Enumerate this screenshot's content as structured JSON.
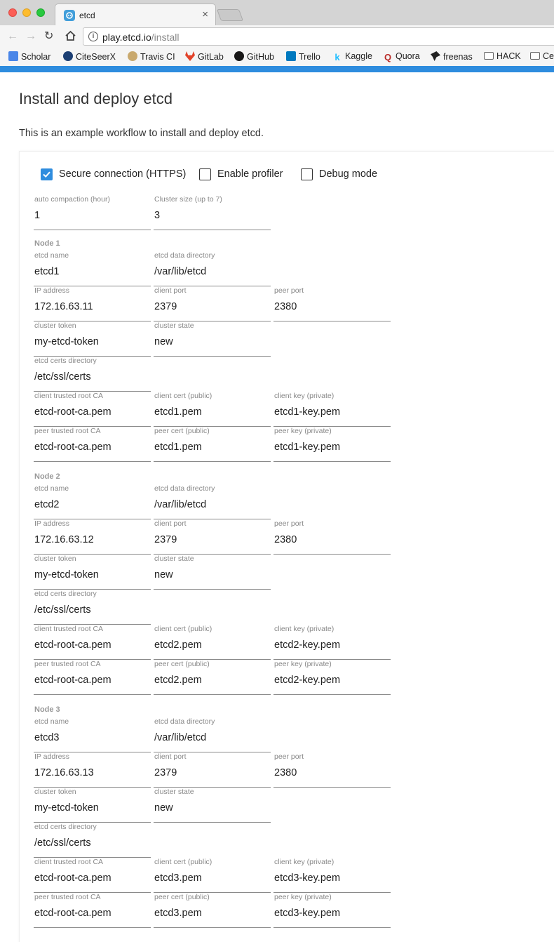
{
  "browser": {
    "tab_title": "etcd",
    "tab_close": "×",
    "url_host": "play.etcd.io",
    "url_path": "/install",
    "bookmarks": [
      "Scholar",
      "CiteSeerX",
      "Travis CI",
      "GitLab",
      "GitHub",
      "Trello",
      "Kaggle",
      "Quora",
      "freenas",
      "HACK",
      "Ce"
    ],
    "accent_color": "#2e8cde"
  },
  "page": {
    "title": "Install and deploy etcd",
    "description": "This is an example workflow to install and deploy etcd."
  },
  "options": {
    "secure": {
      "label": "Secure connection (HTTPS)",
      "checked": true
    },
    "profiler": {
      "label": "Enable profiler",
      "checked": false
    },
    "debug": {
      "label": "Debug mode",
      "checked": false
    }
  },
  "cluster": {
    "auto_compaction_label": "auto compaction (hour)",
    "auto_compaction": "1",
    "size_label": "Cluster size (up to 7)",
    "size": "3"
  },
  "labels": {
    "name": "etcd name",
    "data_dir": "etcd data directory",
    "ip": "IP address",
    "client_port": "client port",
    "peer_port": "peer port",
    "token": "cluster token",
    "state": "cluster state",
    "certs_dir": "etcd certs directory",
    "client_ca": "client trusted root CA",
    "client_cert": "client cert (public)",
    "client_key": "client key (private)",
    "peer_ca": "peer trusted root CA",
    "peer_cert": "peer cert (public)",
    "peer_key": "peer key (private)"
  },
  "nodes": [
    {
      "heading": "Node 1",
      "name": "etcd1",
      "data_dir": "/var/lib/etcd",
      "ip": "172.16.63.11",
      "client_port": "2379",
      "peer_port": "2380",
      "token": "my-etcd-token",
      "state": "new",
      "certs_dir": "/etc/ssl/certs",
      "client_ca": "etcd-root-ca.pem",
      "client_cert": "etcd1.pem",
      "client_key": "etcd1-key.pem",
      "peer_ca": "etcd-root-ca.pem",
      "peer_cert": "etcd1.pem",
      "peer_key": "etcd1-key.pem"
    },
    {
      "heading": "Node 2",
      "name": "etcd2",
      "data_dir": "/var/lib/etcd",
      "ip": "172.16.63.12",
      "client_port": "2379",
      "peer_port": "2380",
      "token": "my-etcd-token",
      "state": "new",
      "certs_dir": "/etc/ssl/certs",
      "client_ca": "etcd-root-ca.pem",
      "client_cert": "etcd2.pem",
      "client_key": "etcd2-key.pem",
      "peer_ca": "etcd-root-ca.pem",
      "peer_cert": "etcd2.pem",
      "peer_key": "etcd2-key.pem"
    },
    {
      "heading": "Node 3",
      "name": "etcd3",
      "data_dir": "/var/lib/etcd",
      "ip": "172.16.63.13",
      "client_port": "2379",
      "peer_port": "2380",
      "token": "my-etcd-token",
      "state": "new",
      "certs_dir": "/etc/ssl/certs",
      "client_ca": "etcd-root-ca.pem",
      "client_cert": "etcd3.pem",
      "client_key": "etcd3-key.pem",
      "peer_ca": "etcd-root-ca.pem",
      "peer_cert": "etcd3.pem",
      "peer_key": "etcd3-key.pem"
    }
  ]
}
